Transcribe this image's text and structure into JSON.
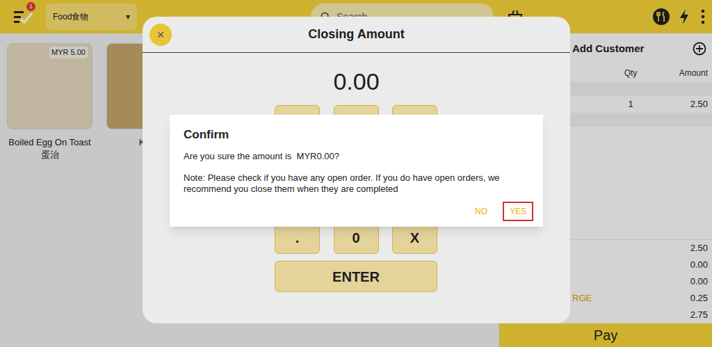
{
  "top_bar": {
    "menu_badge": "1",
    "category": "Food食物",
    "category_arrow": "▾",
    "search_placeholder": "Search"
  },
  "products": [
    {
      "name": "Boiled Egg On Toast蛋治",
      "price": "MYR 5.00"
    },
    {
      "name": "Kaca"
    }
  ],
  "order": {
    "add_customer": "Add Customer",
    "columns": [
      "Qty",
      "Amount"
    ],
    "rows": [
      {
        "qty": "1",
        "amount": "2.50"
      }
    ],
    "totals": [
      {
        "label": "",
        "value": "2.50"
      },
      {
        "label": "",
        "value": "0.00"
      },
      {
        "label": "",
        "value": "0.00"
      },
      {
        "label": "RGE",
        "value": "0.25"
      },
      {
        "label": "",
        "value": "2.75"
      }
    ],
    "pay": "Pay"
  },
  "modal": {
    "title": "Closing Amount",
    "close": "×",
    "amount": "0.00",
    "keys": [
      ".",
      "0",
      "X"
    ],
    "enter": "ENTER"
  },
  "confirm": {
    "title": "Confirm",
    "message": "Are you sure the amount is  MYR0.00?",
    "note": "Note: Please check if you have any open order. If you do have open orders, we recommend you close them when they are completed",
    "buttons": [
      {
        "label": "NO",
        "selected": false
      },
      {
        "label": "YES",
        "selected": true
      }
    ]
  }
}
